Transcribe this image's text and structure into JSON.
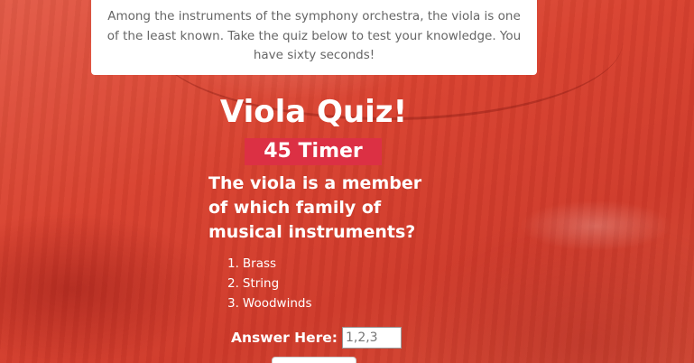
{
  "intro": {
    "text": "Among the instruments of the symphony orchestra, the viola is one of the least known. Take the quiz below to test your knowledge. You have sixty seconds!"
  },
  "quiz": {
    "title": "Viola Quiz!",
    "timer": {
      "value": "45",
      "label": "Timer"
    },
    "question": "The viola is a member of which family of musical instruments?",
    "options": [
      {
        "num": "1.",
        "label": "Brass"
      },
      {
        "num": "2.",
        "label": "String"
      },
      {
        "num": "3.",
        "label": "Woodwinds"
      }
    ],
    "answer": {
      "label": "Answer Here:",
      "placeholder": "1,2,3",
      "value": ""
    },
    "submit_label": ""
  },
  "colors": {
    "timer_bg": "#dc3044",
    "background": "#d8412f",
    "card_bg": "#ffffff",
    "intro_text": "#666666"
  }
}
